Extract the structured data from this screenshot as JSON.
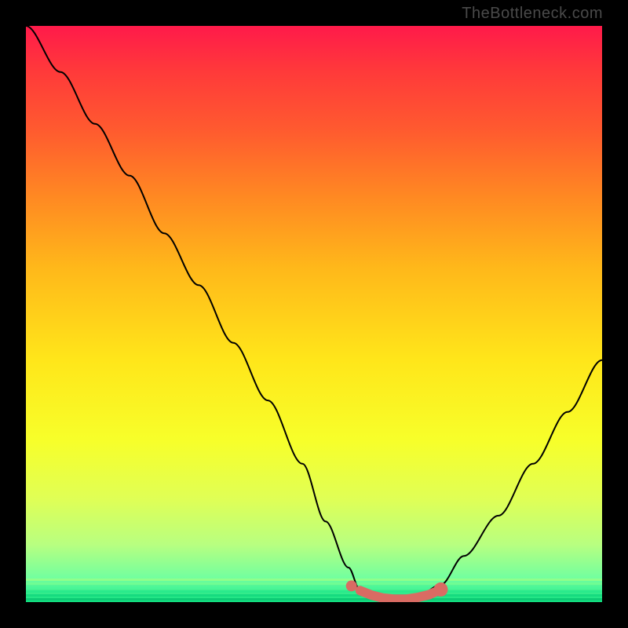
{
  "watermark": "TheBottleneck.com",
  "chart_data": {
    "type": "line",
    "title": "",
    "xlabel": "",
    "ylabel": "",
    "xlim": [
      0,
      100
    ],
    "ylim": [
      0,
      100
    ],
    "grid": false,
    "series": [
      {
        "name": "bottleneck-curve",
        "x": [
          0,
          6,
          12,
          18,
          24,
          30,
          36,
          42,
          48,
          52,
          56,
          58,
          62,
          66,
          68,
          72,
          76,
          82,
          88,
          94,
          100
        ],
        "y": [
          100,
          92,
          83,
          74,
          64,
          55,
          45,
          35,
          24,
          14,
          6,
          2,
          0.5,
          0.5,
          1,
          3,
          8,
          15,
          24,
          33,
          42
        ],
        "color": "#000000",
        "stroke_width": 2
      }
    ],
    "highlight": {
      "name": "optimal-range",
      "x": [
        58,
        60,
        62,
        64,
        66,
        68,
        70,
        72
      ],
      "y": [
        2,
        1.2,
        0.7,
        0.5,
        0.5,
        0.8,
        1.3,
        2.2
      ],
      "color": "#d96b63",
      "marker_radius": 7,
      "end_marker_radius": 9
    },
    "background_gradient": {
      "top": "#ff1a4a",
      "mid1": "#ff8a22",
      "mid2": "#ffe61a",
      "bottom": "#10e080"
    }
  }
}
